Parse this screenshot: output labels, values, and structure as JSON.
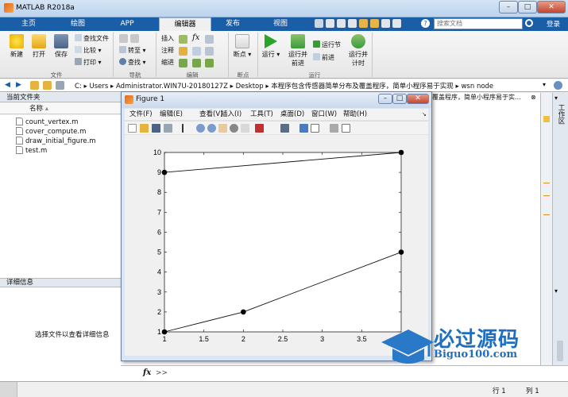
{
  "app": {
    "title": "MATLAB R2018a"
  },
  "tabs": [
    {
      "label": "主页"
    },
    {
      "label": "绘图"
    },
    {
      "label": "APP"
    },
    {
      "label": "编辑器"
    },
    {
      "label": "发布"
    },
    {
      "label": "视图"
    }
  ],
  "search": {
    "placeholder": "搜索文档"
  },
  "login": {
    "label": "登录"
  },
  "ribbon": {
    "file": {
      "new": "新建",
      "open": "打开",
      "save": "保存",
      "find_files": "查找文件",
      "compare": "比较",
      "print": "打印",
      "group": "文件"
    },
    "navigate": {
      "goto": "转至",
      "find": "查找",
      "group": "导航"
    },
    "edit": {
      "insert": "插入",
      "comment": "注释",
      "indent": "缩进",
      "fx": "fx",
      "group": "编辑"
    },
    "breakpoints": {
      "label": "断点",
      "group": "断点"
    },
    "run": {
      "run": "运行",
      "run_advance": "运行并\n前进",
      "run_section": "运行节",
      "advance": "前进",
      "run_time": "运行并\n计时",
      "group": "运行"
    }
  },
  "address": {
    "path": [
      "C:",
      "Users",
      "Administrator.WIN7U-20180127Z",
      "Desktop",
      "本程序包含传感器简单分布及覆盖程序，简单小程序易于实现",
      "wsn node"
    ]
  },
  "left_pane": {
    "current_folder": "当前文件夹",
    "column_name": "名称",
    "files": [
      "count_vertex.m",
      "cover_compute.m",
      "draw_initial_figure.m",
      "test.m"
    ],
    "details_title": "详细信息",
    "details_message": "选择文件以查看详细信息"
  },
  "right_tab": {
    "truncated_path": "覆盖程序，简单小程序易于实...",
    "workspace": "工作区"
  },
  "command": {
    "prompt": ">>",
    "fx": "fx"
  },
  "status": {
    "row_label": "行",
    "row": "1",
    "col_label": "列",
    "col": "1"
  },
  "figure": {
    "title": "Figure 1",
    "menu": [
      "文件(F)",
      "编辑(E)",
      "查看(V)",
      "插入(I)",
      "工具(T)",
      "桌面(D)",
      "窗口(W)",
      "帮助(H)"
    ]
  },
  "chart_data": {
    "type": "line",
    "title": "",
    "xlabel": "",
    "ylabel": "",
    "xlim": [
      1,
      4
    ],
    "ylim": [
      1,
      10
    ],
    "xticks": [
      "1",
      "1.5",
      "2",
      "2.5",
      "3",
      "3.5"
    ],
    "yticks": [
      "1",
      "2",
      "3",
      "4",
      "5",
      "6",
      "7",
      "8",
      "9",
      "10"
    ],
    "series": [
      {
        "x": [
          1,
          4
        ],
        "y": [
          9,
          10
        ]
      },
      {
        "x": [
          1,
          2,
          4
        ],
        "y": [
          1,
          2,
          5
        ]
      }
    ],
    "grid": false
  },
  "watermark": {
    "brand": "必过源码",
    "url": "Biguo100.com"
  },
  "colors": {
    "accent": "#1b5ea8",
    "run": "#2aa52a"
  }
}
